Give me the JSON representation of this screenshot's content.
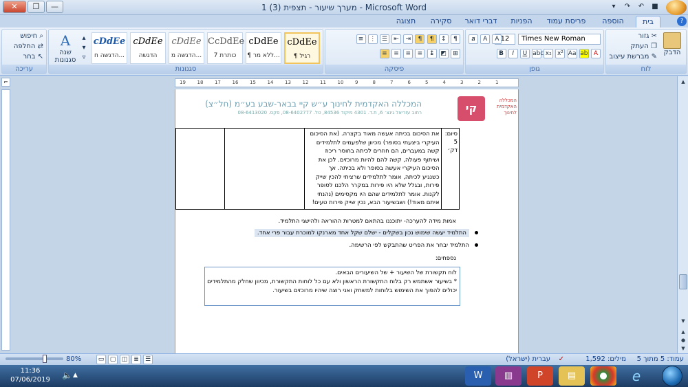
{
  "window": {
    "title": "מערך שיעור - תצפית (3) 1 - Microsoft Word",
    "minimize": "—",
    "maximize": "❐",
    "close": "✕"
  },
  "tabs": [
    "בית",
    "הוספה",
    "פריסת עמוד",
    "הפניות",
    "דברי דואר",
    "סקירה",
    "תצוגה"
  ],
  "ribbon": {
    "clipboard": {
      "label": "לוח",
      "paste": "הדבק",
      "cut": "גזור",
      "copy": "העתק",
      "format_painter": "מברשת עיצוב"
    },
    "font": {
      "label": "גופן",
      "font_name": "Times New Roman",
      "font_size": "12"
    },
    "paragraph": {
      "label": "פיסקה"
    },
    "styles": {
      "label": "סגנונות",
      "items": [
        {
          "sample": "cDdEe",
          "name": "¶ רגיל"
        },
        {
          "sample": "cDdEe",
          "name": "¶ ללא מר..."
        },
        {
          "sample": "CcDdEe",
          "name": "כותרת 7"
        },
        {
          "sample": "cDdEe",
          "name": "הדגשה מ..."
        },
        {
          "sample": "cDdEe",
          "name": "הדגשה"
        },
        {
          "sample": "cDdEe",
          "name": "הדגשה ח..."
        }
      ],
      "change_styles": "שנה סגנונות"
    },
    "editing": {
      "label": "עריכה",
      "find": "חיפוש",
      "replace": "החלפה",
      "select": "בחר"
    }
  },
  "ruler": {
    "numbers": [
      "19",
      "18",
      "17",
      "16",
      "15",
      "14",
      "13",
      "12",
      "11",
      "10",
      "9",
      "8",
      "7",
      "6",
      "5",
      "4",
      "3",
      "2",
      "1"
    ]
  },
  "document": {
    "header_title": "המכללה האקדמית לחינוך ע״ש קיי בבאר-שבע בע״מ (חל״צ)",
    "header_sub": "רחוב עזריאל גינצ׳ 6, ת.ד. 4301 מיקוד 84536, טל. 08-6402777, פקס. 08-6413020",
    "logo_text": "המכללה האקדמית לחינוך",
    "table": {
      "label_col": "סיום:",
      "label_time": "5 דק׳",
      "text_lines": [
        "את הסיכום בכיתה אעשה מאוד בקצרה. (את הסיכום",
        "העיקרי ביצעתי בסופר) מכיוון שלפעמים לתלמידים",
        "קשה במעברים, הם חוזרים לכיתה בחוסר ריכוז",
        "ושיתוף פעולה, קשה להם להיות מרוכזים. לכן את",
        "הסיכום העיקרי אעשה בסופר ולא בכיתה. אך",
        "כשנגיע לכיתה, אומר לתלמידים שרציתי להכין שייק",
        "פירות, ובגלל שלא היו פירות במקרר הלכנו לסופר",
        "לקנות. אומר לתלמידים שהם היו מקסימים (נהנתי",
        "איתם מאוד!) ושבשיעור הבא, נכין שייק פירות טעים!"
      ]
    },
    "assessment": "אמות מידה להערכה- יתוכננו בהתאם למטרות ההוראה ולהישגי התלמיד.",
    "bullets": [
      "התלמיד יעשה שימוש נכון בשקלים - ישלם שקל אחד מארנקו  למוכרת עבור פרי אחד.",
      "התלמיד יבחר את הפריט שהתבקש לפי הרשימה."
    ],
    "appendix_label": "נספחים:",
    "textbox_lines": [
      "לוח תקשורת של השיעור + של השיעורים הבאים.",
      "* בשיעור אשתמש רק בלוח התקשורת הראשון ולא עם כל לוחות התקשורת, מכיוון שחלק מהתלמידים",
      "יכולים להפוך את השימוש בלוחות למשחק ואני רוצה שיהיו מרוכזים בשיעור."
    ]
  },
  "status": {
    "page": "עמוד: 5 מתוך 5",
    "words": "מילים: 1,592",
    "language": "עברית (ישראל)",
    "zoom": "80%"
  },
  "taskbar": {
    "time": "11:36",
    "date": "07/06/2019"
  }
}
